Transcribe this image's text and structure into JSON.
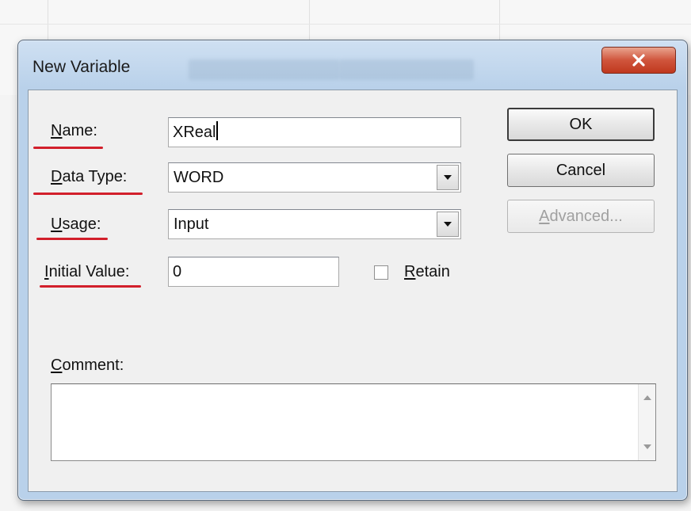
{
  "window": {
    "title": "New Variable",
    "close_icon": "close-icon"
  },
  "form": {
    "name_label": {
      "hotkey": "N",
      "rest": "ame:"
    },
    "name_value": "XReal",
    "data_type_label": {
      "hotkey": "D",
      "rest": "ata Type:"
    },
    "data_type_value": "WORD",
    "usage_label": {
      "hotkey": "U",
      "rest": "sage:"
    },
    "usage_value": "Input",
    "initial_value_label": {
      "hotkey": "I",
      "rest": "nitial Value:"
    },
    "initial_value_value": "0",
    "retain_label": {
      "hotkey": "R",
      "rest": "etain"
    },
    "retain_checked": false,
    "comment_label": {
      "hotkey": "C",
      "rest": "omment:"
    },
    "comment_value": ""
  },
  "buttons": {
    "ok": "OK",
    "cancel": "Cancel",
    "advanced": {
      "hotkey": "A",
      "rest": "dvanced..."
    }
  },
  "colors": {
    "annotation_red": "#d21f2b",
    "close_button": "#c0381e"
  }
}
